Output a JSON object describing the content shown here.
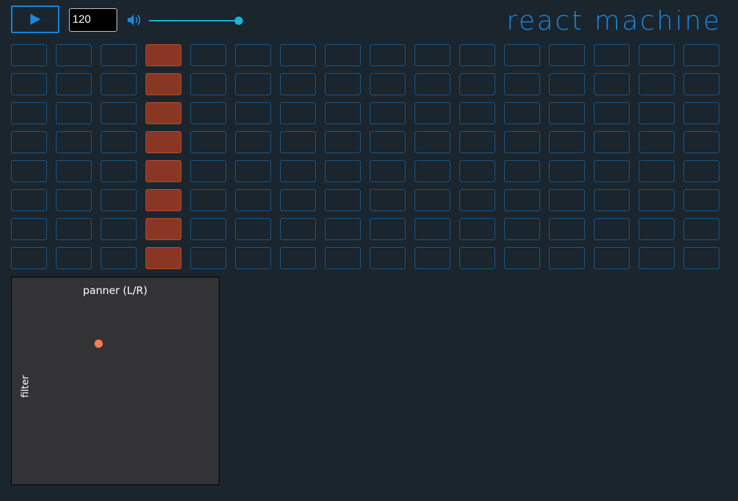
{
  "app": {
    "title": "react machine"
  },
  "transport": {
    "play_icon": "play-icon",
    "tempo_value": "120",
    "volume_icon": "speaker-icon",
    "volume_level": 1.0
  },
  "colors": {
    "accent": "#1a87e0",
    "slider": "#1ab7d6",
    "active_step": "#8a3625",
    "cell_border": "#1c5a8c",
    "background": "#1a252d",
    "pad_background": "#333335",
    "pad_dot": "#ff7a4d"
  },
  "sequencer": {
    "rows": 8,
    "steps": 16,
    "active": [
      [
        0,
        0,
        0,
        1,
        0,
        0,
        0,
        0,
        0,
        0,
        0,
        0,
        0,
        0,
        0,
        0
      ],
      [
        0,
        0,
        0,
        1,
        0,
        0,
        0,
        0,
        0,
        0,
        0,
        0,
        0,
        0,
        0,
        0
      ],
      [
        0,
        0,
        0,
        1,
        0,
        0,
        0,
        0,
        0,
        0,
        0,
        0,
        0,
        0,
        0,
        0
      ],
      [
        0,
        0,
        0,
        1,
        0,
        0,
        0,
        0,
        0,
        0,
        0,
        0,
        0,
        0,
        0,
        0
      ],
      [
        0,
        0,
        0,
        1,
        0,
        0,
        0,
        0,
        0,
        0,
        0,
        0,
        0,
        0,
        0,
        0
      ],
      [
        0,
        0,
        0,
        1,
        0,
        0,
        0,
        0,
        0,
        0,
        0,
        0,
        0,
        0,
        0,
        0
      ],
      [
        0,
        0,
        0,
        1,
        0,
        0,
        0,
        0,
        0,
        0,
        0,
        0,
        0,
        0,
        0,
        0
      ],
      [
        0,
        0,
        0,
        1,
        0,
        0,
        0,
        0,
        0,
        0,
        0,
        0,
        0,
        0,
        0,
        0
      ]
    ]
  },
  "xy_pad": {
    "x_label": "panner (L/R)",
    "y_label": "filter",
    "x_value": 0.42,
    "y_value": 0.68
  }
}
